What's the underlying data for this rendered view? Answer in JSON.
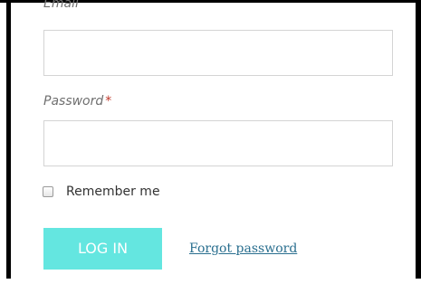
{
  "form": {
    "email": {
      "label": "Email",
      "value": ""
    },
    "password": {
      "label": "Password",
      "required_mark": "*",
      "value": ""
    },
    "remember": {
      "label": "Remember me",
      "checked": false
    },
    "login_button_label": "LOG IN",
    "forgot_password_label": "Forgot password"
  },
  "colors": {
    "accent": "#64e6e0",
    "link": "#2a6f8f",
    "required": "#c0392b"
  }
}
